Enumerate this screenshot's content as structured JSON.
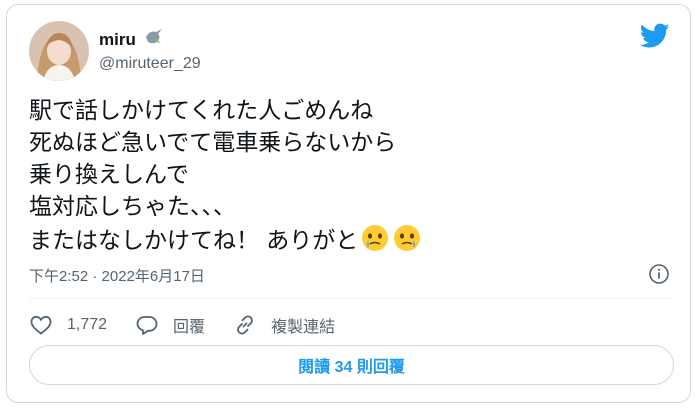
{
  "tweet": {
    "display_name": "miru",
    "name_emoji_icon": "dove-icon",
    "handle": "@miruteer_29",
    "text_lines": [
      "駅で話しかけてくれた人ごめんね",
      "死ぬほど急いでて電車乗らないから",
      "乗り換えしんで",
      "塩対応しちゃた、、、",
      "またはなしかけてね！ ありがと"
    ],
    "trailing_emojis": [
      "face-holding-back-tears-icon",
      "face-holding-back-tears-icon"
    ],
    "timestamp": "下午2:52 · 2022年6月17日",
    "like_count": "1,772",
    "reply_label": "回覆",
    "copy_link_label": "複製連結",
    "read_replies_label": "閱讀 34 則回覆"
  },
  "colors": {
    "brand_blue": "#1d9bf0",
    "text_primary": "#0f1419",
    "text_secondary": "#536471",
    "border": "#cfd9de"
  }
}
